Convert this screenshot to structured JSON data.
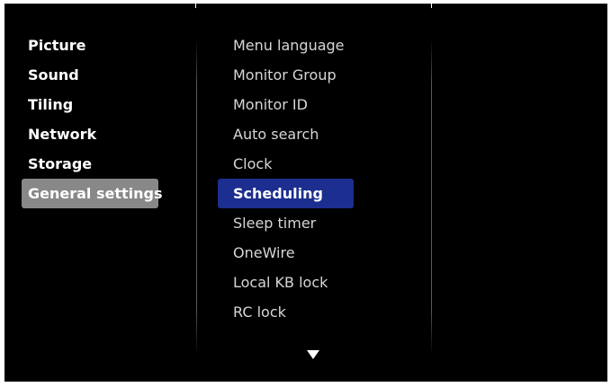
{
  "main_menu": {
    "items": [
      {
        "label": "Picture",
        "selected": false
      },
      {
        "label": "Sound",
        "selected": false
      },
      {
        "label": "Tiling",
        "selected": false
      },
      {
        "label": "Network",
        "selected": false
      },
      {
        "label": "Storage",
        "selected": false
      },
      {
        "label": "General settings",
        "selected": true
      }
    ]
  },
  "sub_menu": {
    "items": [
      {
        "label": "Menu language",
        "selected": false
      },
      {
        "label": "Monitor Group",
        "selected": false
      },
      {
        "label": "Monitor ID",
        "selected": false
      },
      {
        "label": "Auto search",
        "selected": false
      },
      {
        "label": "Clock",
        "selected": false
      },
      {
        "label": "Scheduling",
        "selected": true
      },
      {
        "label": "Sleep timer",
        "selected": false
      },
      {
        "label": "OneWire",
        "selected": false
      },
      {
        "label": "Local KB lock",
        "selected": false
      },
      {
        "label": "RC lock",
        "selected": false
      }
    ]
  },
  "colors": {
    "background": "#000000",
    "main_selected": "#888888",
    "sub_selected": "#1c2e8f",
    "text": "#ffffff"
  },
  "icons": {
    "scroll_down": "down-triangle-icon"
  }
}
